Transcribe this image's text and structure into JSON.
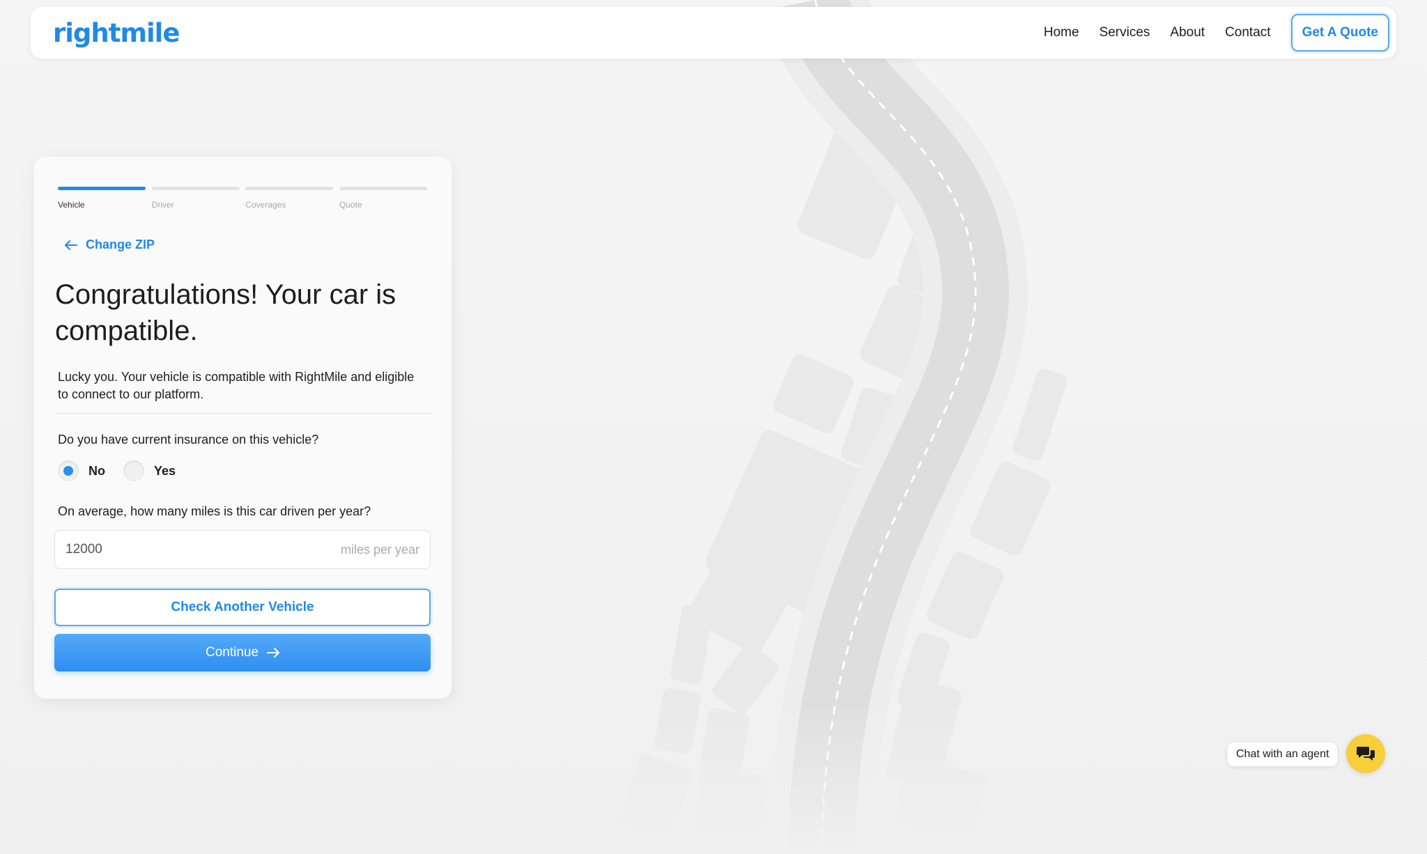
{
  "brand": {
    "logo_text": "rightmile",
    "accent": "#1f8ae6"
  },
  "nav": {
    "links": [
      "Home",
      "Services",
      "About",
      "Contact"
    ],
    "cta_label": "Get A Quote"
  },
  "progress": {
    "steps": [
      "Vehicle",
      "Driver",
      "Coverages",
      "Quote"
    ],
    "active_index": 0
  },
  "form": {
    "back_link": "Change ZIP",
    "back_icon": "arrow-left-icon",
    "title": "Congratulations! Your car is compatible.",
    "description": "Lucky you. Your vehicle is compatible with RightMile and eligible to connect to our platform.",
    "insurance_question": "Do you have current insurance on this vehicle?",
    "insurance_options": [
      "No",
      "Yes"
    ],
    "insurance_selected": "No",
    "miles_question": "On average, how many miles is this car driven per year?",
    "miles_value": "12000",
    "miles_unit": "miles per year",
    "check_another_label": "Check Another Vehicle",
    "continue_label": "Continue",
    "continue_icon": "arrow-right-icon"
  },
  "chat": {
    "label": "Chat with an agent",
    "icon": "chat-bubbles-icon",
    "color": "#f7cf3b"
  }
}
